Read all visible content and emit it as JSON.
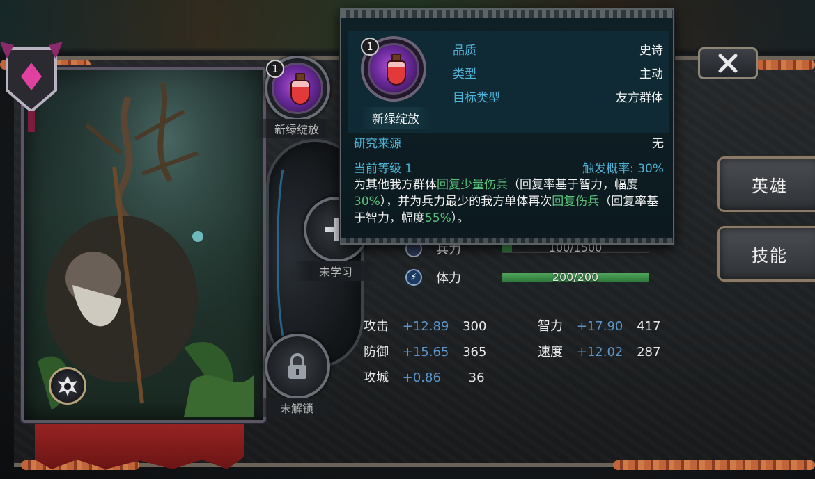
{
  "hero": {
    "skill_slots": [
      {
        "level": "1",
        "label": "新绿绽放"
      },
      {
        "label": "未学习"
      },
      {
        "label": "未解锁"
      }
    ]
  },
  "stats": {
    "troops": {
      "label": "兵力",
      "value": "100/1500",
      "fraction": 0.0667
    },
    "stamina": {
      "label": "体力",
      "value": "200/200",
      "fraction": 1.0
    },
    "attributes_left": [
      {
        "name": "攻击",
        "bonus": "+12.89",
        "value": "300"
      },
      {
        "name": "防御",
        "bonus": "+15.65",
        "value": "365"
      },
      {
        "name": "攻城",
        "bonus": "+0.86",
        "value": "36"
      }
    ],
    "attributes_right": [
      {
        "name": "智力",
        "bonus": "+17.90",
        "value": "417"
      },
      {
        "name": "速度",
        "bonus": "+12.02",
        "value": "287"
      }
    ]
  },
  "side_buttons": {
    "hero": "英雄",
    "skill": "技能"
  },
  "tooltip": {
    "level": "1",
    "skill_name": "新绿绽放",
    "quality_label": "品质",
    "quality_value": "史诗",
    "type_label": "类型",
    "type_value": "主动",
    "target_label": "目标类型",
    "target_value": "友方群体",
    "source_label": "研究来源",
    "source_value": "无",
    "current_level": "当前等级 1",
    "trigger": "触发概率: 30%",
    "desc": {
      "p1": "为其他我方群体",
      "h1": "回复少量伤兵",
      "p2": "（回复率基于智力，幅度",
      "h2": "30%",
      "p3": "），并为兵力最少的我方单体再次",
      "h3": "回复伤兵",
      "p4": "（回复率基于智力，幅度",
      "h4": "55%",
      "p5": "）。"
    }
  },
  "colors": {
    "accent_blue": "#4fb3d8",
    "highlight_green": "#58c27a",
    "bonus_blue": "#5b95c9",
    "bar_green": "#3d8f48"
  }
}
